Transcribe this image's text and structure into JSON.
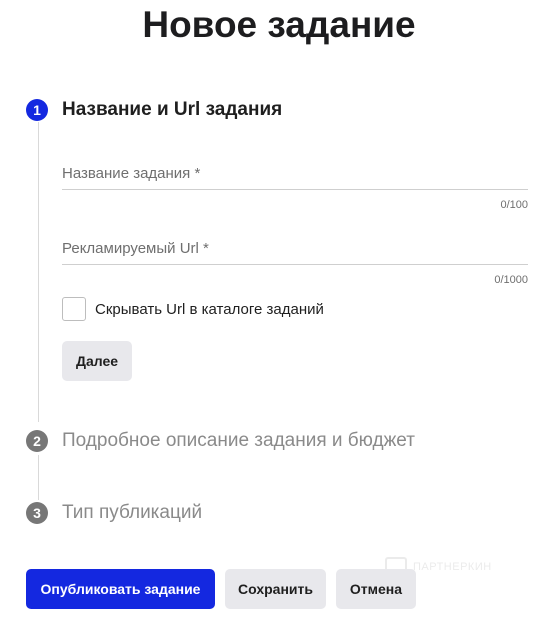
{
  "page": {
    "title": "Новое задание"
  },
  "steps": [
    {
      "number": "1",
      "title": "Название и Url задания",
      "state": "active"
    },
    {
      "number": "2",
      "title": "Подробное описание задания и бюджет",
      "state": "inactive"
    },
    {
      "number": "3",
      "title": "Тип публикаций",
      "state": "inactive"
    }
  ],
  "form": {
    "task_name": {
      "label": "Название задания *",
      "value": "",
      "counter": "0/100"
    },
    "ad_url": {
      "label": "Рекламируемый Url *",
      "value": "",
      "counter": "0/1000"
    },
    "hide_url_checkbox": {
      "label": "Скрывать Url в каталоге заданий",
      "checked": false
    },
    "next_button": "Далее"
  },
  "actions": {
    "publish": "Опубликовать задание",
    "save": "Сохранить",
    "cancel": "Отмена"
  },
  "watermark": {
    "text": "ПАРТНЕРКИН",
    "icon": "partnerkin-logo-icon"
  },
  "colors": {
    "accent": "#1428e0",
    "inactive_badge": "#777777",
    "secondary_button": "#e8e8ec"
  }
}
